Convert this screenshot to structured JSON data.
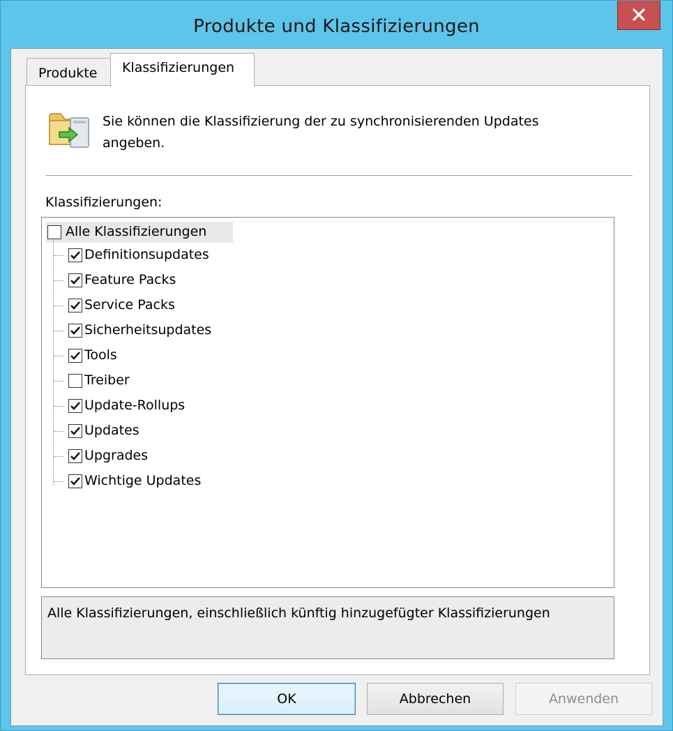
{
  "window": {
    "title": "Produkte und Klassifizierungen",
    "close_label": "x"
  },
  "tabs": [
    {
      "label": "Produkte",
      "selected": false
    },
    {
      "label": "Klassifizierungen",
      "selected": true
    }
  ],
  "info": {
    "icon": "folder-sync-icon",
    "text": "Sie können die Klassifizierung der zu synchronisierenden Updates angeben."
  },
  "list": {
    "label": "Klassifizierungen:",
    "root": {
      "label": "Alle Klassifizierungen",
      "checked": false
    },
    "items": [
      {
        "label": "Definitionsupdates",
        "checked": true
      },
      {
        "label": "Feature Packs",
        "checked": true
      },
      {
        "label": "Service Packs",
        "checked": true
      },
      {
        "label": "Sicherheitsupdates",
        "checked": true
      },
      {
        "label": "Tools",
        "checked": true
      },
      {
        "label": "Treiber",
        "checked": false
      },
      {
        "label": "Update-Rollups",
        "checked": true
      },
      {
        "label": "Updates",
        "checked": true
      },
      {
        "label": "Upgrades",
        "checked": true
      },
      {
        "label": "Wichtige Updates",
        "checked": true
      }
    ]
  },
  "description": "Alle Klassifizierungen, einschließlich künftig hinzugefügter Klassifizierungen",
  "buttons": {
    "ok": "OK",
    "cancel": "Abbrechen",
    "apply": "Anwenden",
    "apply_enabled": false
  },
  "colors": {
    "title_bar": "#5dc4ea",
    "close_button": "#c75050",
    "checkmark": "#1a1a1a"
  }
}
